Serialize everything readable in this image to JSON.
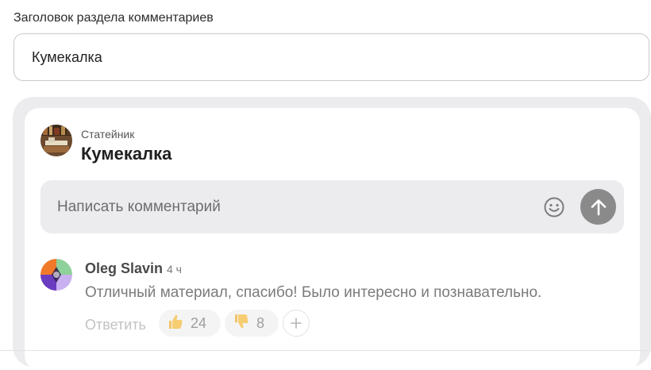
{
  "settings": {
    "field_label": "Заголовок раздела комментариев",
    "field_value": "Кумекалка"
  },
  "preview": {
    "site_name": "Статейник",
    "section_title": "Кумекалка",
    "comment_placeholder": "Написать комментарий",
    "emoji_icon": "smiley-icon",
    "send_icon": "arrow-up-icon",
    "comment": {
      "author": "Oleg Slavin",
      "time": "4 ч",
      "text": "Отличный материал, спасибо! Было интересно и познавательно.",
      "reply_label": "Ответить",
      "reactions": [
        {
          "icon": "thumbs-up-icon",
          "count": "24"
        },
        {
          "icon": "thumbs-down-icon",
          "count": "8"
        }
      ],
      "add_reaction_icon": "plus-icon"
    }
  },
  "colors": {
    "send_button": "#8a8a8a",
    "panel_bg": "#ececef"
  }
}
